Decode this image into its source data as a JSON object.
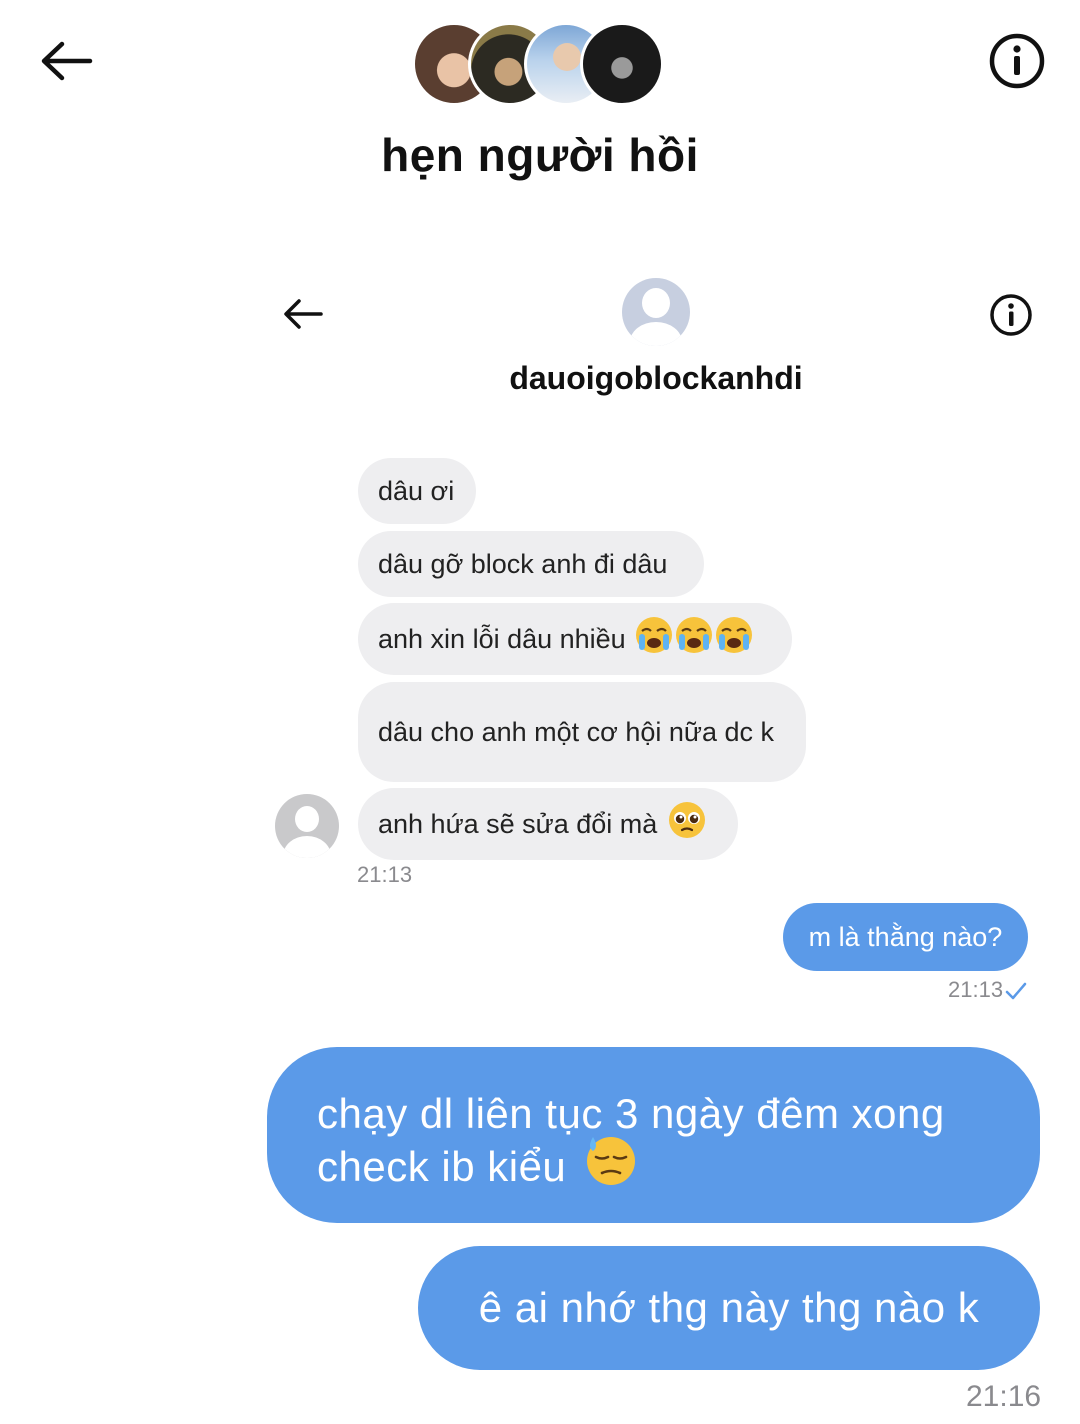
{
  "header": {
    "back_icon": "back-arrow-icon",
    "info_icon": "info-icon",
    "group_title": "hẹn người hồi",
    "member_avatars": [
      "avatar-1",
      "avatar-2",
      "avatar-3",
      "avatar-4"
    ]
  },
  "inner_chat": {
    "contact_name": "dauoigoblockanhdi",
    "incoming": [
      {
        "text": "dâu ơi"
      },
      {
        "text": "dâu gỡ block anh đi dâu"
      },
      {
        "text": "anh xin lỗi dâu nhiều"
      },
      {
        "text": "dâu cho anh một cơ hội nữa dc k"
      },
      {
        "text": "anh hứa sẽ sửa đổi mà"
      }
    ],
    "incoming_time": "21:13",
    "outgoing": {
      "text": "m là thằng nào?",
      "time": "21:13",
      "status_icon": "check-icon"
    }
  },
  "messages": [
    {
      "text": "chạy dl liên tục 3 ngày đêm xong check ib kiểu"
    },
    {
      "text": "ê ai nhớ thg này thg nào k"
    }
  ],
  "last_time": "21:16",
  "colors": {
    "outgoing_bubble": "#5b9ae8",
    "incoming_bubble": "#eeeef0",
    "check": "#5b9ae8"
  }
}
